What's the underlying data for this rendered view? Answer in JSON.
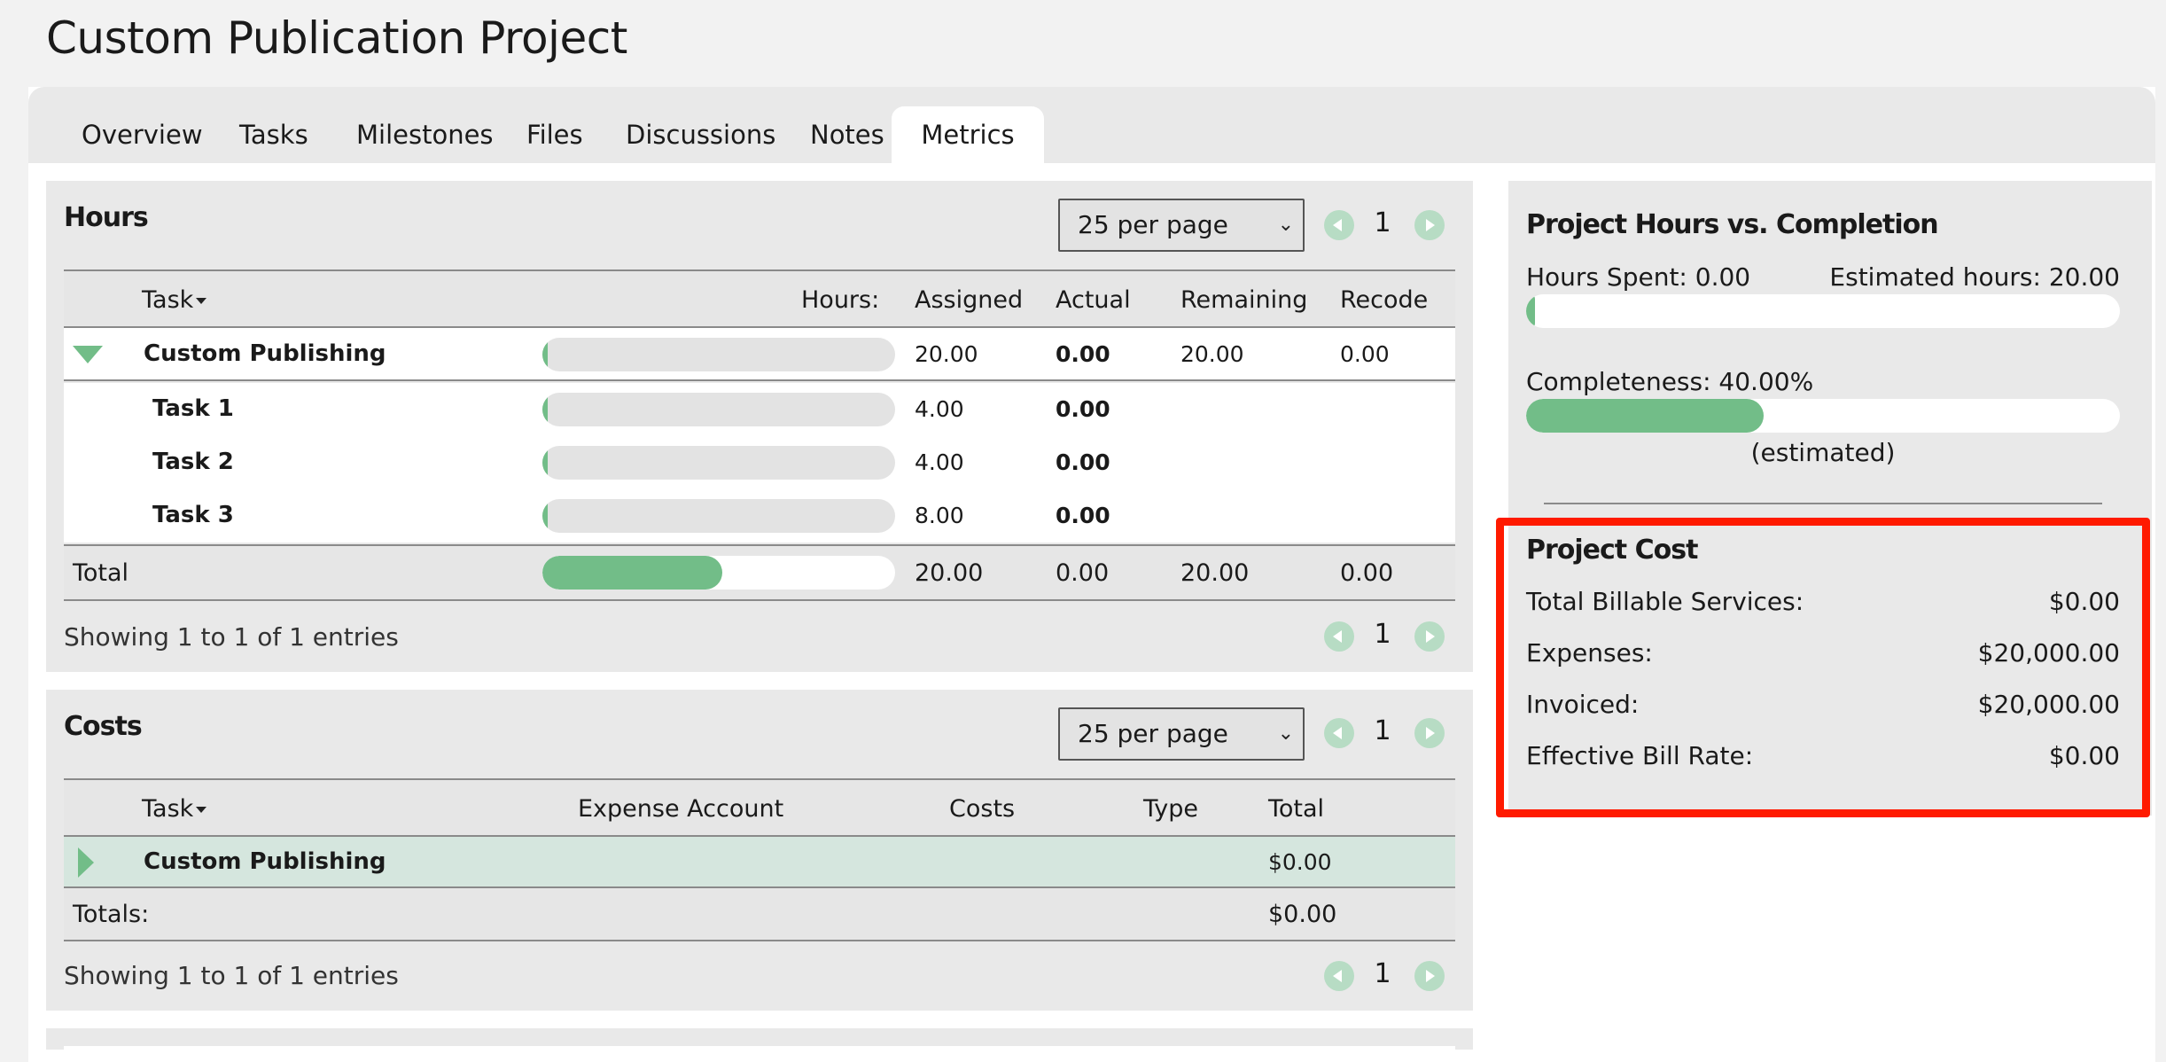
{
  "page": {
    "title": "Custom Publication Project"
  },
  "tabs": [
    {
      "label": "Overview"
    },
    {
      "label": "Tasks"
    },
    {
      "label": "Milestones"
    },
    {
      "label": "Files"
    },
    {
      "label": "Discussions"
    },
    {
      "label": "Notes"
    },
    {
      "label": "Metrics",
      "active": true
    }
  ],
  "hours": {
    "title": "Hours",
    "per_page": "25 per page",
    "page": "1",
    "columns": {
      "task": "Task",
      "hours": "Hours:",
      "assigned": "Assigned",
      "actual": "Actual",
      "remaining": "Remaining",
      "recode": "Recode"
    },
    "group": {
      "name": "Custom Publishing",
      "assigned": "20.00",
      "actual": "0.00",
      "remaining": "20.00",
      "recode": "0.00",
      "progress": 0.01
    },
    "tasks": [
      {
        "name": "Task 1",
        "assigned": "4.00",
        "actual": "0.00",
        "progress": 0.01
      },
      {
        "name": "Task 2",
        "assigned": "4.00",
        "actual": "0.00",
        "progress": 0.01
      },
      {
        "name": "Task 3",
        "assigned": "8.00",
        "actual": "0.00",
        "progress": 0.01
      }
    ],
    "total": {
      "label": "Total",
      "assigned": "20.00",
      "actual": "0.00",
      "remaining": "20.00",
      "recode": "0.00",
      "progress": 0.51
    },
    "footer": "Showing 1 to 1 of 1 entries",
    "footer_page": "1"
  },
  "costs": {
    "title": "Costs",
    "per_page": "25 per page",
    "page": "1",
    "columns": {
      "task": "Task",
      "expense_account": "Expense Account",
      "costs": "Costs",
      "type": "Type",
      "total": "Total"
    },
    "group": {
      "name": "Custom Publishing",
      "total": "$0.00"
    },
    "totals": {
      "label": "Totals:",
      "total": "$0.00"
    },
    "footer": "Showing 1 to 1 of 1 entries",
    "footer_page": "1"
  },
  "sidebar": {
    "hours_title": "Project Hours vs. Completion",
    "hours_spent": "Hours Spent: 0.00",
    "estimated_hours": "Estimated hours: 20.00",
    "hours_progress": 0.0,
    "completeness": "Completeness: 40.00%",
    "completeness_progress": 0.4,
    "estimated_note": "(estimated)",
    "cost_title": "Project Cost",
    "cost_rows": [
      {
        "label": "Total Billable Services:",
        "value": "$0.00"
      },
      {
        "label": "Expenses:",
        "value": "$20,000.00"
      },
      {
        "label": "Invoiced:",
        "value": "$20,000.00"
      },
      {
        "label": "Effective Bill Rate:",
        "value": "$0.00"
      }
    ]
  },
  "colors": {
    "accent": "#72bd88",
    "highlight": "#ff1a00",
    "pager": "#b7dcc4"
  }
}
